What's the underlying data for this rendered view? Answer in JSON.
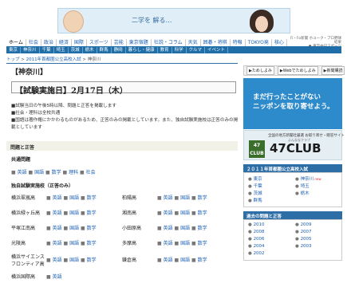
{
  "banner": {
    "text": "二学を 解る…"
  },
  "nav_top": [
    "ホーム",
    "社会",
    "政治",
    "経済",
    "国際",
    "スポーツ",
    "芸能",
    "東京宿題",
    "社説・コラム",
    "天気",
    "囲碁・将棋",
    "特報",
    "TOKYO発",
    "核心"
  ],
  "nav_top_active": "ホーム",
  "publisher": [
    "Fi・Fo新聞 ホユーク・プロ野球結果",
    "● 東京中日スポーツ"
  ],
  "nav_regions": [
    "東京",
    "神奈川",
    "千葉",
    "埼玉",
    "茨城",
    "栃木",
    "群馬",
    "静岡",
    "暮らし・健康",
    "教育",
    "科学",
    "クルマ",
    "イベント"
  ],
  "breadcrumb": {
    "home": "トップ",
    "sep": " > ",
    "section": "2011年首都圏公立高校入試",
    "current": "神奈川"
  },
  "main": {
    "prefecture": "【神奈川】",
    "exam_header": "【試験実施日】2月17日（木）",
    "notes": [
      "■試験当日の午後5時以降、問題と正答を掲載します",
      "■社会・理科は全校共通",
      "■国語は著作権にかかわるものがあるため、正答のみの掲載としています。また、独自試験実施校は正答のみの掲載としています"
    ],
    "section_title": "問題と正答",
    "common_label": "共通問題",
    "common_links": [
      "英語",
      "国語",
      "数学",
      "理科",
      "社会"
    ],
    "independent_label": "独自試験実施校（正答のみ）",
    "schools": [
      {
        "name": "横浜翠嵐高",
        "subjects": [
          "英語",
          "国語",
          "数学"
        ]
      },
      {
        "name": "柏陽高",
        "subjects": [
          "英語",
          "国語",
          "数学"
        ]
      },
      {
        "name": "横浜緑ヶ丘高",
        "subjects": [
          "英語",
          "国語",
          "数学"
        ]
      },
      {
        "name": "湘南高",
        "subjects": [
          "英語",
          "国語",
          "数学"
        ]
      },
      {
        "name": "平塚江南高",
        "subjects": [
          "英語",
          "国語",
          "数学"
        ]
      },
      {
        "name": "小田原高",
        "subjects": [
          "英語",
          "国語",
          "数学"
        ]
      },
      {
        "name": "光陵高",
        "subjects": [
          "英語",
          "国語",
          "数学"
        ]
      },
      {
        "name": "多摩高",
        "subjects": [
          "英語",
          "国語",
          "数学"
        ]
      },
      {
        "name": "横浜サイエンスフロンティア高",
        "subjects": [
          "英語",
          "国語",
          "数学"
        ]
      },
      {
        "name": "鎌倉高",
        "subjects": [
          "英語",
          "国語",
          "数学"
        ]
      },
      {
        "name": "横浜国際高",
        "subjects": [
          "英語"
        ]
      }
    ]
  },
  "sidebar": {
    "tabs": [
      "▶ためしよみ",
      "▶Webでためしよみ",
      "▶新聞購読"
    ],
    "ad1_lines": [
      "まだ行ったことがない",
      "ニッポンを取り寄せよう。"
    ],
    "ad2": {
      "caption": "全国の地方新聞社厳選 お取り寄せ・贈答サイト",
      "logo": "47 CLUB",
      "club": "47CLUB",
      "sub": "よんななクラブ"
    },
    "exam_panel": {
      "title": "２０１１年首都圏公立高校入試",
      "left": [
        "東京",
        "千葉",
        "茨城",
        "群馬"
      ],
      "right": [
        "神奈川",
        "埼玉",
        "栃木"
      ],
      "new_label": "new"
    },
    "past_panel": {
      "title": "過去の問題と正答",
      "left": [
        "2010",
        "2008",
        "2006",
        "2004",
        "2002"
      ],
      "right": [
        "2009",
        "2007",
        "2005",
        "2003"
      ]
    }
  }
}
